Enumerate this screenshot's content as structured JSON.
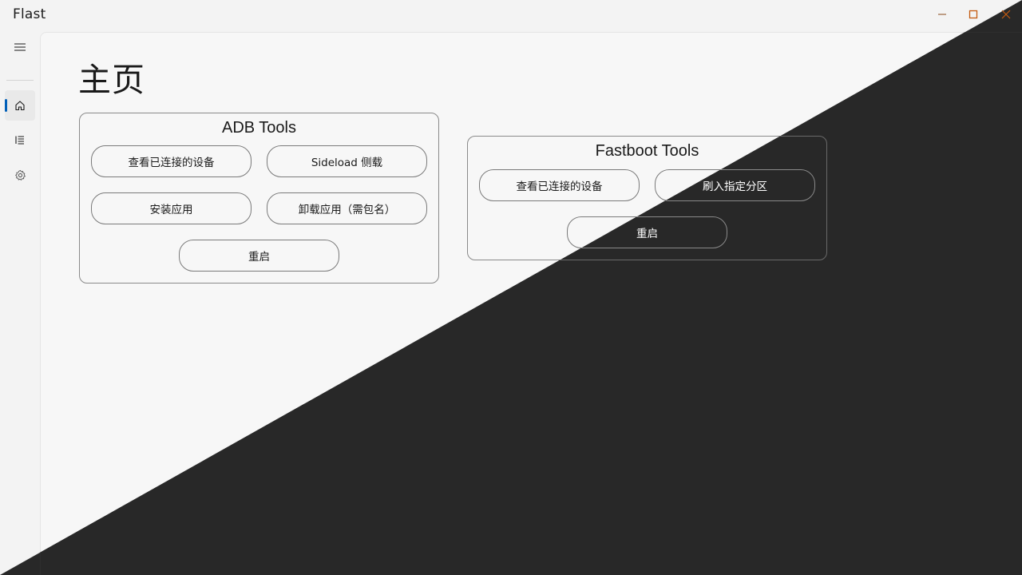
{
  "window": {
    "title": "Flast",
    "controls": {
      "minimize": "minimize-icon",
      "maximize": "maximize-icon",
      "close": "close-icon"
    }
  },
  "nav": {
    "items": [
      {
        "icon": "home-icon",
        "selected": true
      },
      {
        "icon": "list-icon",
        "selected": false
      },
      {
        "icon": "gear-icon",
        "selected": false
      }
    ],
    "menu_icon": "hamburger-menu-icon"
  },
  "page": {
    "title": "主页"
  },
  "adb": {
    "title": "ADB Tools",
    "buttons": {
      "devices": "查看已连接的设备",
      "sideload": "Sideload 侧载",
      "install": "安装应用",
      "uninstall": "卸载应用（需包名）",
      "reboot": "重启"
    }
  },
  "fastboot": {
    "title": "Fastboot Tools",
    "buttons": {
      "devices": "查看已连接的设备",
      "flash": "刷入指定分区",
      "reboot": "重启"
    }
  },
  "theme": {
    "light_bg": "#f7f7f7",
    "dark_bg": "#282828",
    "accent": "#005fb8",
    "close_hover_accent": "#c42b1c"
  }
}
